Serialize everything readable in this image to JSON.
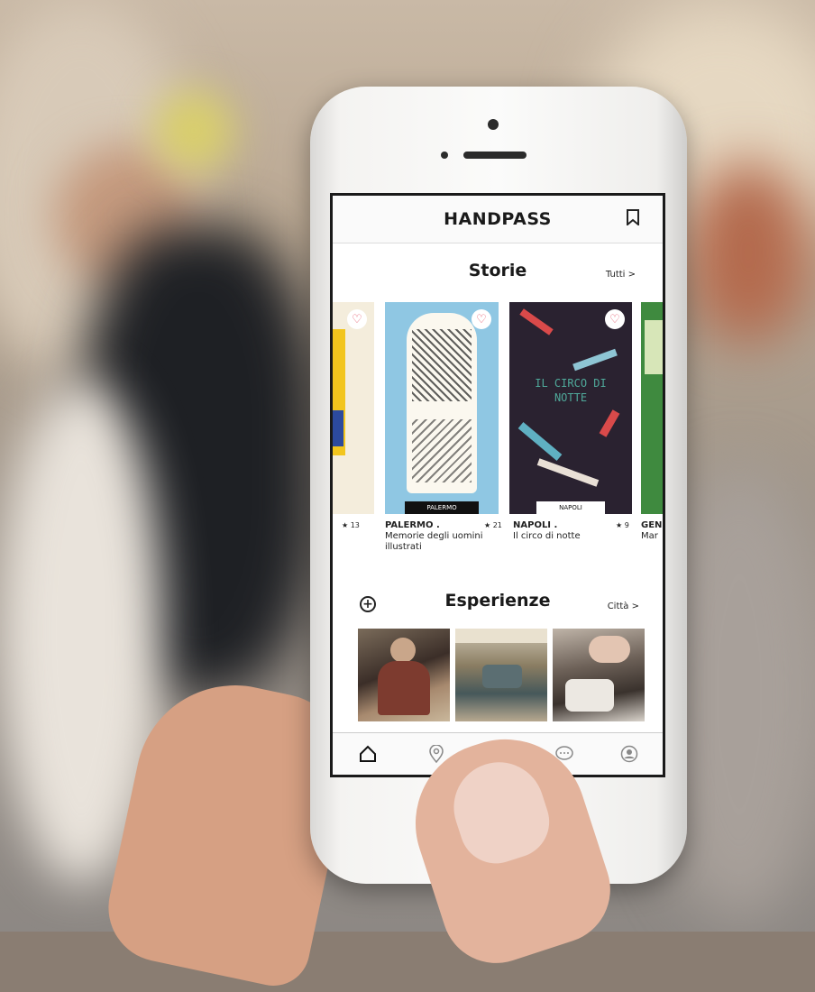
{
  "app": {
    "logo_text": "HANDPASS",
    "header_icons": [
      "bookmark-icon"
    ]
  },
  "storie": {
    "title": "Storie",
    "link_label": "Tutti >",
    "cards": [
      {
        "rating": "★ 13",
        "city": "",
        "subtitle": ""
      },
      {
        "rating": "★ 21",
        "city": "PALERMO .",
        "subtitle": "Memorie degli uomini illustrati",
        "cover_label": "PALERMO"
      },
      {
        "rating": "★ 9",
        "city": "NAPOLI .",
        "subtitle": "Il circo di notte",
        "cover_title": "IL CIRCO DI NOTTE",
        "cover_label": "NAPOLI"
      },
      {
        "rating": "",
        "city": "GEN",
        "subtitle": "Mar"
      }
    ]
  },
  "esperienze": {
    "title": "Esperienze",
    "link_label": "Città >",
    "photos": [
      "artisan-knitting-photo",
      "courtyard-photo",
      "ceramics-photo"
    ]
  },
  "tabbar": {
    "items": [
      "home-icon",
      "location-pin-icon",
      "cart-icon",
      "chat-icon",
      "profile-icon"
    ],
    "active": "home-icon"
  },
  "colors": {
    "accent_heart": "#e4576b",
    "card_palermo_bg": "#8fc7e3",
    "card_napoli_bg": "#2a2230",
    "card_napoli_text": "#4fa99a"
  }
}
